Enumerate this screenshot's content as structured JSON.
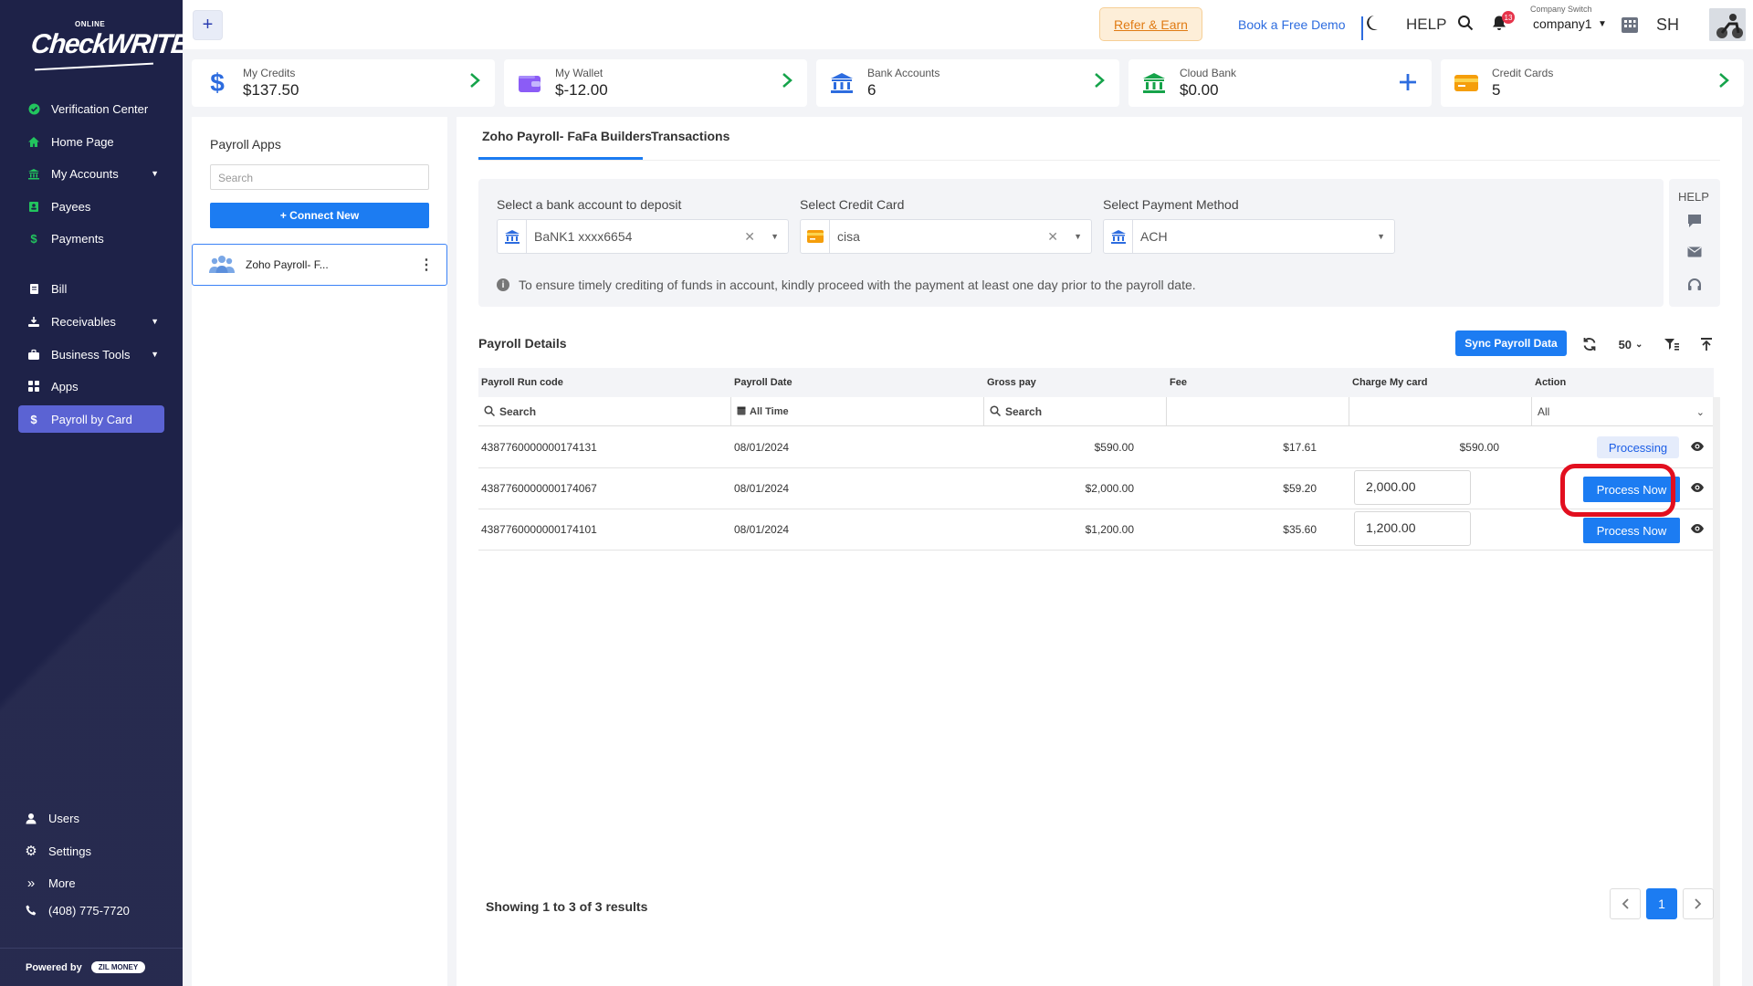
{
  "brand": {
    "small": "ONLINE",
    "big": "CheckWRITER"
  },
  "sidebar": {
    "items": [
      {
        "label": "Verification Center",
        "icon": "check-circle-icon"
      },
      {
        "label": "Home Page",
        "icon": "home-icon"
      },
      {
        "label": "My Accounts",
        "icon": "bank-icon"
      },
      {
        "label": "Payees",
        "icon": "payee-icon"
      },
      {
        "label": "Payments",
        "icon": "dollar-icon"
      },
      {
        "label": "Bill",
        "icon": "bill-icon"
      },
      {
        "label": "Receivables",
        "icon": "receivables-icon"
      },
      {
        "label": "Business Tools",
        "icon": "briefcase-icon"
      },
      {
        "label": "Apps",
        "icon": "apps-icon"
      },
      {
        "label": "Payroll by Card",
        "icon": "dollar-icon"
      }
    ],
    "bottom": [
      {
        "label": "Users"
      },
      {
        "label": "Settings"
      },
      {
        "label": "More"
      },
      {
        "label": "(408) 775-7720"
      }
    ],
    "powered_by": "Powered by",
    "zil": "ZIL MONEY"
  },
  "topbar": {
    "refer": "Refer & Earn",
    "demo": "Book a Free Demo",
    "help": "HELP",
    "notifications": "13",
    "company_switch_label": "Company Switch",
    "company": "company1",
    "initials": "SH"
  },
  "cards": [
    {
      "label": "My Credits",
      "value": "$137.50"
    },
    {
      "label": "My Wallet",
      "value": "$-12.00"
    },
    {
      "label": "Bank Accounts",
      "value": "6"
    },
    {
      "label": "Cloud Bank",
      "value": "$0.00"
    },
    {
      "label": "Credit Cards",
      "value": "5"
    }
  ],
  "apps_panel": {
    "title": "Payroll Apps",
    "search_placeholder": "Search",
    "connect": "+ Connect New",
    "item": "Zoho Payroll- F..."
  },
  "tabs": [
    "Zoho Payroll- FaFa Builders",
    "Transactions"
  ],
  "filters": {
    "bank_label": "Select a bank account to deposit",
    "bank_value": "BaNK1 xxxx6654",
    "card_label": "Select Credit Card",
    "card_value": "cisa",
    "method_label": "Select Payment Method",
    "method_value": "ACH",
    "note": "To ensure timely crediting of funds in account, kindly proceed with the payment at least one day prior to the payroll date."
  },
  "help_side": "HELP",
  "payroll": {
    "title": "Payroll Details",
    "sync": "Sync Payroll Data",
    "page_size": "50",
    "columns": [
      "Payroll Run code",
      "Payroll Date",
      "Gross pay",
      "Fee",
      "Charge My card",
      "Action"
    ],
    "filter_row": {
      "search1": "Search",
      "date": "All Time",
      "search2": "Search",
      "action": "All"
    },
    "rows": [
      {
        "code": "4387760000000174131",
        "date": "08/01/2024",
        "gross": "$590.00",
        "fee": "$17.61",
        "charge": "$590.00",
        "action": "Processing"
      },
      {
        "code": "4387760000000174067",
        "date": "08/01/2024",
        "gross": "$2,000.00",
        "fee": "$59.20",
        "charge": "2,000.00",
        "action": "Process Now"
      },
      {
        "code": "4387760000000174101",
        "date": "08/01/2024",
        "gross": "$1,200.00",
        "fee": "$35.60",
        "charge": "1,200.00",
        "action": "Process Now"
      }
    ],
    "showing": "Showing 1 to 3 of 3 results",
    "page": "1"
  }
}
